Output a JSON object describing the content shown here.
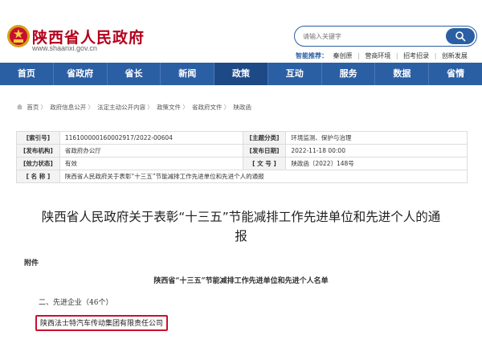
{
  "header": {
    "site_title": "陕西省人民政府",
    "site_url": "www.shaanxi.gov.cn",
    "search_placeholder": "请输入关键字",
    "hot_label": "智能推荐：",
    "hot_items": [
      "秦创原",
      "营商环境",
      "招考招录",
      "创新发展"
    ]
  },
  "nav": {
    "items": [
      "首页",
      "省政府",
      "省长",
      "新闻",
      "政策",
      "互动",
      "服务",
      "数据",
      "省情"
    ],
    "active_index": 4
  },
  "breadcrumb": [
    "首页",
    "政府信息公开",
    "法定主动公开内容",
    "政策文件",
    "省政府文件",
    "陕政函"
  ],
  "info": {
    "index_label": "[索引号]",
    "index_value": "11610000016000291​7/2022-00604",
    "topic_label": "[主题分类]",
    "topic_value": "环境监测、保护与治理",
    "publisher_label": "[发布机构]",
    "publisher_value": "省政府办公厅",
    "date_label": "[发布日期]",
    "date_value": "2022-11-18 00:00",
    "status_label": "[效力状态]",
    "status_value": "有效",
    "docno_label": "[ 文 号 ]",
    "docno_value": "陕政函〔2022〕148号",
    "name_label": "[ 名 称 ]",
    "name_value": "陕西省人民政府关于表彰“十三五”节能减排工作先进单位和先进个人的通报"
  },
  "document": {
    "title": "陕西省人民政府关于表彰“十三五”节能减排工作先进单位和先进个人的通报",
    "attachment_label": "附件",
    "list_title": "陕西省“十三五”节能减排工作先进单位和先进个人名单",
    "section_heading": "二、先进企业（46个）",
    "highlighted_company": "陕西法士特汽车传动集团有限责任公司"
  },
  "colors": {
    "brand_red": "#b3001b",
    "nav_blue": "#2b5fa3",
    "highlight_red": "#c8102e"
  },
  "icons": {
    "emblem": "national-emblem-icon",
    "search": "search-icon",
    "breadcrumb_home": "home-icon"
  }
}
